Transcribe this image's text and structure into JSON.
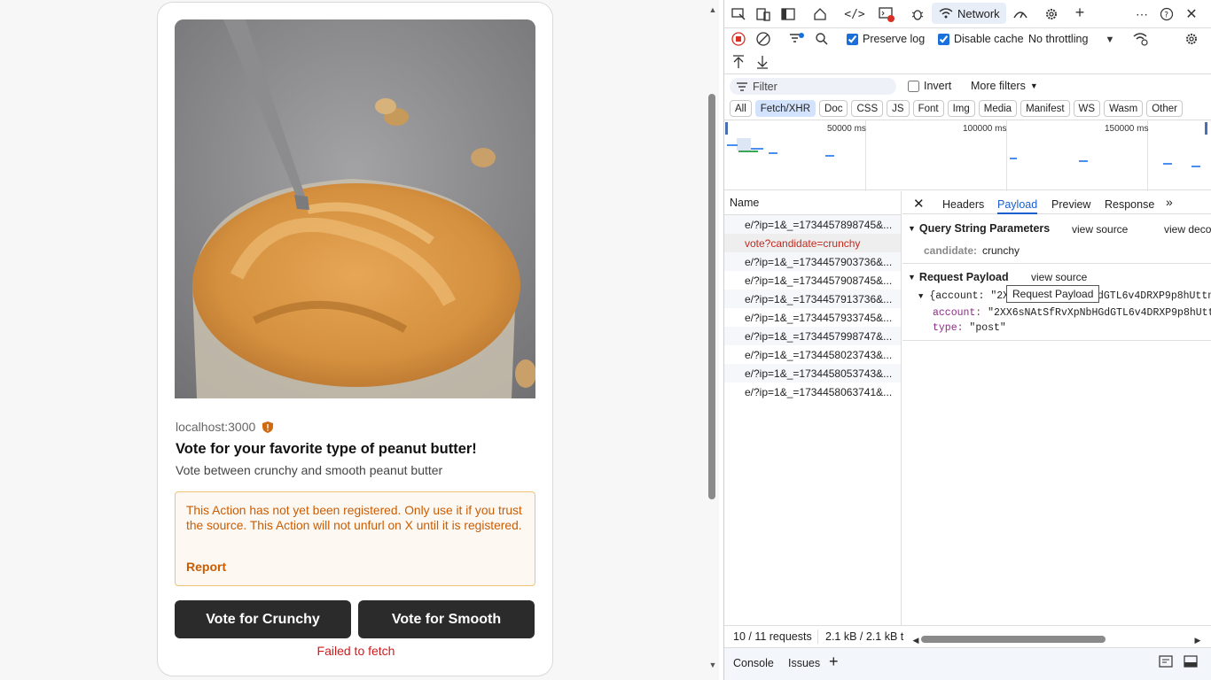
{
  "left": {
    "host": "localhost:3000",
    "title": "Vote for your favorite type of peanut butter!",
    "description": "Vote between crunchy and smooth peanut butter",
    "warning": "This Action has not yet been registered. Only use it if you trust the source. This Action will not unfurl on X until it is registered.",
    "report_label": "Report",
    "buttons": [
      "Vote for Crunchy",
      "Vote for Smooth"
    ],
    "error": "Failed to fetch"
  },
  "devtools": {
    "network_tab": "Network",
    "preserve_log": "Preserve log",
    "disable_cache": "Disable cache",
    "throttling": "No throttling",
    "filter_placeholder": "Filter",
    "invert": "Invert",
    "more_filters": "More filters",
    "chips": [
      "All",
      "Fetch/XHR",
      "Doc",
      "CSS",
      "JS",
      "Font",
      "Img",
      "Media",
      "Manifest",
      "WS",
      "Wasm",
      "Other"
    ],
    "active_chip": "Fetch/XHR",
    "overview_labels": [
      "50000 ms",
      "100000 ms",
      "150000 ms"
    ],
    "name_header": "Name",
    "requests": [
      "e/?ip=1&_=1734457898745&...",
      "vote?candidate=crunchy",
      "e/?ip=1&_=1734457903736&...",
      "e/?ip=1&_=1734457908745&...",
      "e/?ip=1&_=1734457913736&...",
      "e/?ip=1&_=1734457933745&...",
      "e/?ip=1&_=1734457998747&...",
      "e/?ip=1&_=1734458023743&...",
      "e/?ip=1&_=1734458053743&...",
      "e/?ip=1&_=1734458063741&..."
    ],
    "detail_tabs": [
      "Headers",
      "Payload",
      "Preview",
      "Response"
    ],
    "active_detail_tab": "Payload",
    "query_title": "Query String Parameters",
    "view_source": "view source",
    "view_decoded": "view deco",
    "query_key": "candidate:",
    "query_value": "crunchy",
    "payload_title": "Request Payload",
    "payload_summary_start": "{account: \"2X",
    "payload_summary_end": "dGTL6v4DRXP9p8hUttn",
    "account_key": "account:",
    "account_value": "\"2XX6sNAtSfRvXpNbHGdGTL6v4DRXP9p8hUttn",
    "type_key": "type:",
    "type_value": "\"post\"",
    "tooltip": "Request Payload",
    "status_requests": "10 / 11 requests",
    "status_size": "2.1 kB / 2.1 kB t",
    "drawer_tabs": [
      "Console",
      "Issues"
    ]
  }
}
